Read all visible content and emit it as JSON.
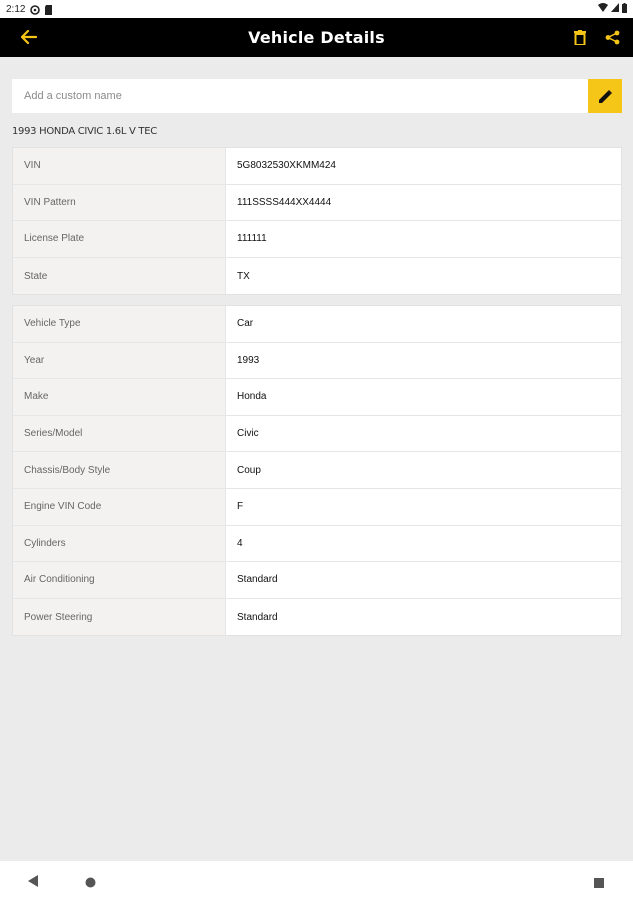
{
  "status_bar": {
    "time": "2:12",
    "icons": [
      "sync-icon",
      "sd-card-icon",
      "wifi-icon",
      "signal-icon",
      "battery-icon"
    ]
  },
  "app_bar": {
    "title": "Vehicle Details",
    "back_icon": "arrow-left-icon",
    "actions": [
      "delete-icon",
      "share-icon"
    ],
    "accent_color": "#f5c518"
  },
  "custom_name": {
    "placeholder": "Add a custom name",
    "value": "",
    "edit_icon": "pencil-icon"
  },
  "vehicle_name": "1993 HONDA CIVIC 1.6L V TEC",
  "identification": [
    {
      "label": "VIN",
      "value": "5G8032530XKMM424"
    },
    {
      "label": "VIN Pattern",
      "value": "111SSSS444XX4444"
    },
    {
      "label": "License Plate",
      "value": "111111"
    },
    {
      "label": "State",
      "value": "TX"
    }
  ],
  "specs": [
    {
      "label": "Vehicle Type",
      "value": "Car"
    },
    {
      "label": "Year",
      "value": "1993"
    },
    {
      "label": "Make",
      "value": "Honda"
    },
    {
      "label": "Series/Model",
      "value": "Civic"
    },
    {
      "label": "Chassis/Body Style",
      "value": "Coup"
    },
    {
      "label": "Engine VIN Code",
      "value": "F"
    },
    {
      "label": "Cylinders",
      "value": "4"
    },
    {
      "label": "Air Conditioning",
      "value": "Standard"
    },
    {
      "label": "Power Steering",
      "value": "Standard"
    }
  ],
  "nav_bar": {
    "buttons": [
      "back-triangle-icon",
      "home-circle-icon",
      "recents-square-icon"
    ]
  }
}
